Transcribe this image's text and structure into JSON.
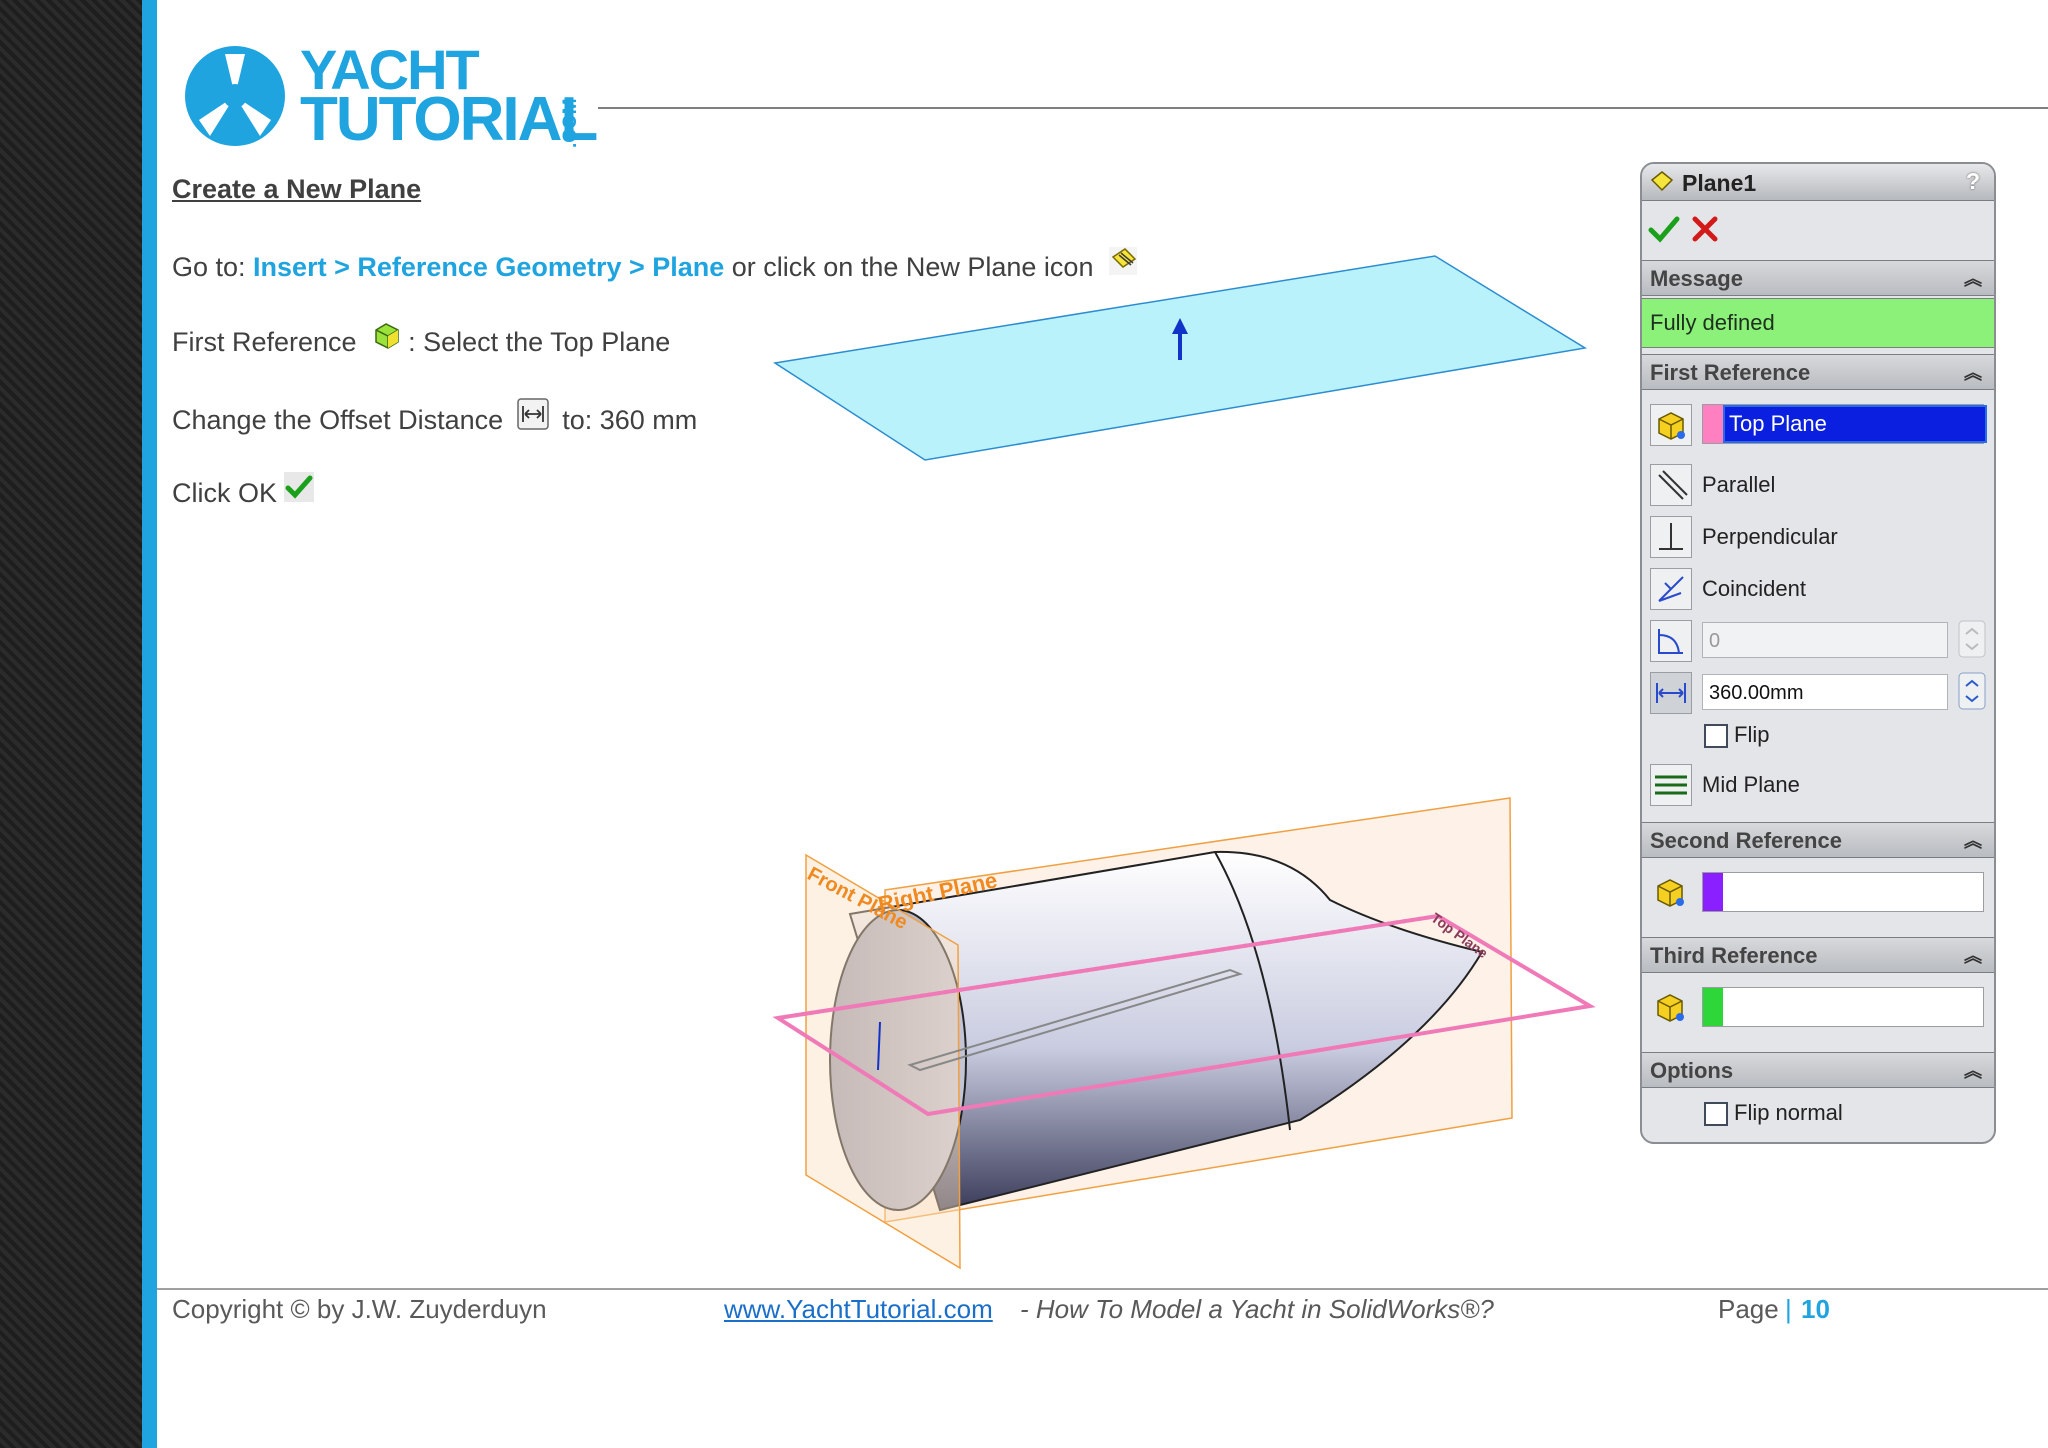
{
  "logo": {
    "line1": "YACHT",
    "line2": "TUTORIAL",
    "suffix": ".COM"
  },
  "instructions": {
    "title": "Create a New Plane",
    "step1": {
      "prefix": "Go to: ",
      "path": "Insert > Reference Geometry > Plane",
      "suffix": " or click on the New Plane icon"
    },
    "step2": {
      "prefix": "First Reference ",
      "suffix": ": Select the Top Plane"
    },
    "step3": {
      "prefix": "Change the Offset Distance ",
      "suffix": " to: 360 mm"
    },
    "step4": {
      "prefix": "Click OK"
    }
  },
  "figure_labels": {
    "front_plane": "Front Plane",
    "right_plane": "Right Plane",
    "top_plane": "Top Plane"
  },
  "property_manager": {
    "title": "Plane1",
    "help": "?",
    "message": {
      "header": "Message",
      "text": "Fully defined"
    },
    "first_reference": {
      "header": "First Reference",
      "selection": "Top Plane",
      "options": [
        "Parallel",
        "Perpendicular",
        "Coincident"
      ],
      "angle_value": "0",
      "distance_value": "360.00mm",
      "flip_label": "Flip",
      "mid_plane_label": "Mid Plane"
    },
    "second_reference": {
      "header": "Second Reference"
    },
    "third_reference": {
      "header": "Third Reference"
    },
    "options": {
      "header": "Options",
      "flip_normal_label": "Flip normal"
    },
    "colors": {
      "first": "#ff80c0",
      "second": "#8a1fff",
      "third": "#2fd63a",
      "message_bg": "#8cf179"
    }
  },
  "footer": {
    "copyright": "Copyright © by J.W. Zuyderduyn",
    "link": "www.YachtTutorial.com",
    "book": " - How To Model a Yacht in SolidWorks®?",
    "page_label": "Page",
    "separator": "|",
    "page_number": "10"
  }
}
